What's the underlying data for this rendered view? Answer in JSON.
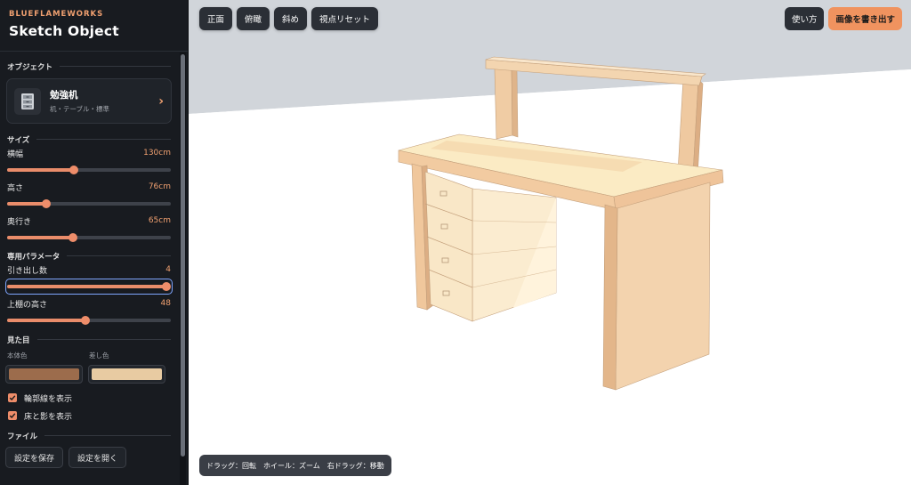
{
  "brand": {
    "tag": "BLUEFLAMEWORKS",
    "title": "Sketch Object"
  },
  "sections": {
    "object": "オブジェクト",
    "size": "サイズ",
    "params": "専用パラメータ",
    "appearance": "見た目",
    "file": "ファイル"
  },
  "object": {
    "name": "勉強机",
    "tags": "机・テーブル・標準",
    "icon": "drawer-cabinet-icon"
  },
  "size": {
    "width": {
      "label": "横幅",
      "value": "130cm",
      "fraction": 0.41
    },
    "height": {
      "label": "高さ",
      "value": "76cm",
      "fraction": 0.24
    },
    "depth": {
      "label": "奥行き",
      "value": "65cm",
      "fraction": 0.4
    }
  },
  "params": {
    "drawers": {
      "label": "引き出し数",
      "value": "4",
      "fraction": 1.0
    },
    "shelf_height": {
      "label": "上棚の高さ",
      "value": "48",
      "fraction": 0.48
    }
  },
  "appearance": {
    "body_color_label": "本体色",
    "accent_color_label": "差し色",
    "body_color": "#9c6c4c",
    "accent_color": "#e8cba2",
    "show_outline": "輪郭線を表示",
    "show_floor": "床と影を表示"
  },
  "file": {
    "save": "設定を保存",
    "open": "設定を開く"
  },
  "view": {
    "front": "正面",
    "top": "俯瞰",
    "oblique": "斜め",
    "reset": "視点リセット"
  },
  "actions": {
    "help": "使い方",
    "export": "画像を書き出す"
  },
  "hint": "ドラッグ：回転　ホイール：ズーム　右ドラッグ：移動",
  "colors": {
    "accent": "#f0935f",
    "panel": "#181b20",
    "floor": "#ffffff",
    "wall": "#d1d5da"
  }
}
